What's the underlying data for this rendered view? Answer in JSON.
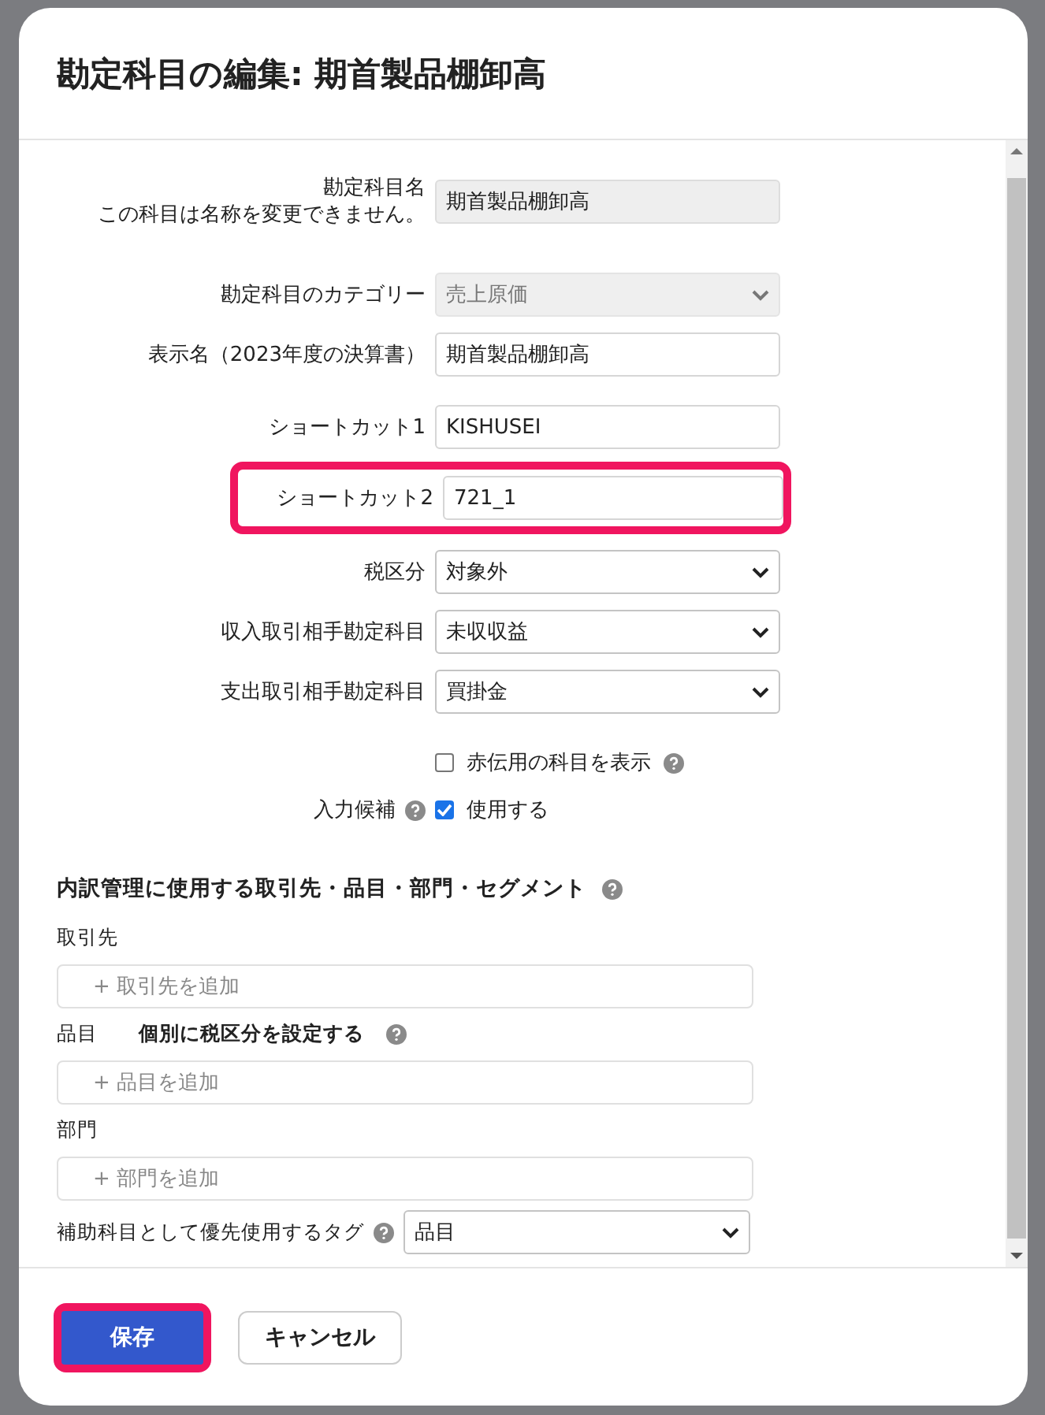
{
  "dialog": {
    "title": "勘定科目の編集: 期首製品棚卸高"
  },
  "fields": [
    {
      "kind": "readonly",
      "label": "勘定科目名",
      "note": "この科目は名称を変更できません。",
      "value": "期首製品棚卸高"
    },
    {
      "kind": "select",
      "label": "勘定科目のカテゴリー",
      "value": "売上原価",
      "disabled": true
    },
    {
      "kind": "text",
      "label": "表示名（2023年度の決算書）",
      "value": "期首製品棚卸高"
    },
    {
      "kind": "text",
      "label": "ショートカット1",
      "value": "KISHUSEI"
    },
    {
      "kind": "text",
      "label": "ショートカット2",
      "value": "721_1",
      "highlighted": true
    },
    {
      "kind": "select",
      "label": "税区分",
      "value": "対象外",
      "disabled": false
    },
    {
      "kind": "select",
      "label": "収入取引相手勘定科目",
      "value": "未収収益",
      "disabled": false
    },
    {
      "kind": "select",
      "label": "支出取引相手勘定科目",
      "value": "買掛金",
      "disabled": false
    },
    {
      "kind": "checkbox",
      "text": "赤伝用の科目を表示",
      "checked": false,
      "help": true
    },
    {
      "kind": "checkbox",
      "label": "入力候補",
      "label_help": true,
      "text": "使用する",
      "checked": true
    }
  ],
  "breakdown": {
    "heading": "内訳管理に使用する取引先・品目・部門・セグメント",
    "groups": [
      {
        "label": "取引先",
        "placeholder": "+ 取引先を追加"
      },
      {
        "label": "品目",
        "option": "個別に税区分を設定する",
        "placeholder": "+ 品目を追加"
      },
      {
        "label": "部門",
        "placeholder": "+ 部門を追加"
      }
    ],
    "tag": {
      "label": "補助科目として優先使用するタグ",
      "value": "品目"
    }
  },
  "buttons": [
    {
      "kind": "primary",
      "label": "保存",
      "highlighted": true
    },
    {
      "kind": "secondary",
      "label": "キャンセル",
      "highlighted": false
    }
  ]
}
